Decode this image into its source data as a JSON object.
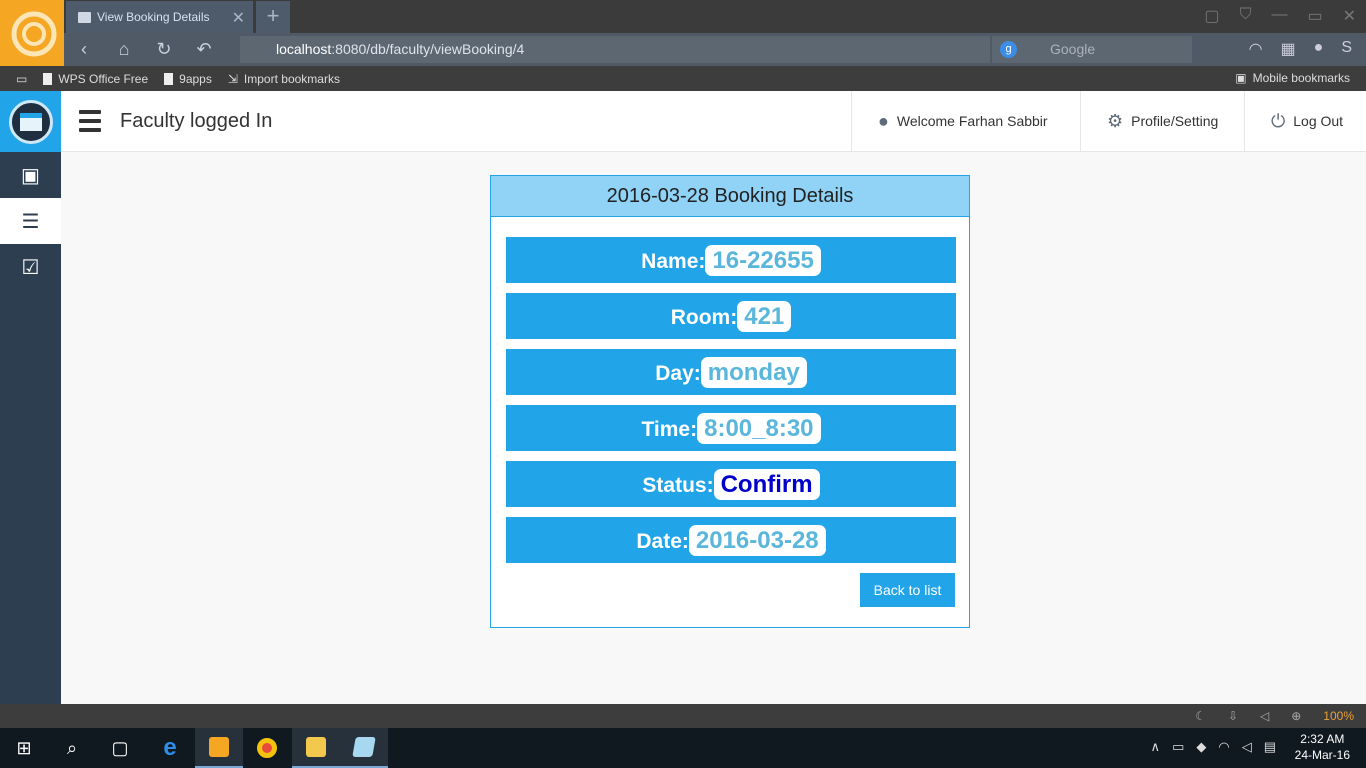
{
  "browser": {
    "tab_title": "View Booking Details",
    "url_host": "localhost",
    "url_rest": ":8080/db/faculty/viewBooking/4",
    "search_placeholder": "Google",
    "bookmarks": [
      "WPS Office Free",
      "9apps",
      "Import bookmarks"
    ],
    "mobile_bookmarks": "Mobile bookmarks",
    "zoom": "100%"
  },
  "header": {
    "title": "Faculty logged In",
    "welcome": "Welcome Farhan Sabbir",
    "profile": "Profile/Setting",
    "logout": "Log Out"
  },
  "panel": {
    "heading": "2016-03-28 Booking Details",
    "rows": [
      {
        "label": "Name:",
        "value": "16-22655"
      },
      {
        "label": "Room:",
        "value": "421"
      },
      {
        "label": "Day:",
        "value": "monday"
      },
      {
        "label": "Time:",
        "value": "8:00_8:30"
      },
      {
        "label": "Status:",
        "value": "Confirm"
      },
      {
        "label": "Date:",
        "value": "2016-03-28"
      }
    ],
    "back_button": "Back to list"
  },
  "taskbar": {
    "time": "2:32 AM",
    "date": "24-Mar-16"
  },
  "colors": {
    "accent": "#22a4e8",
    "panel_header": "#90d3f7",
    "sidebar": "#2d3e50",
    "status_confirm": "#0000cc"
  }
}
